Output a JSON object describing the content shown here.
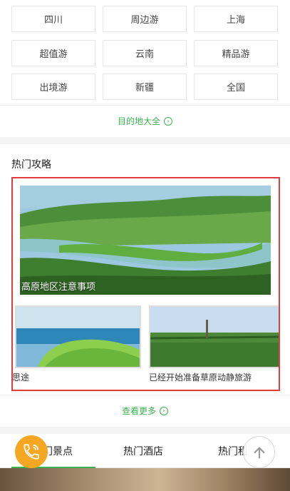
{
  "destinations": {
    "items": [
      {
        "label": "四川"
      },
      {
        "label": "周边游"
      },
      {
        "label": "上海"
      },
      {
        "label": "超值游"
      },
      {
        "label": "云南"
      },
      {
        "label": "精品游"
      },
      {
        "label": "出境游"
      },
      {
        "label": "新疆"
      },
      {
        "label": "全国"
      }
    ],
    "more_label": "目的地大全",
    "more_icon": "circle-arrow-right-icon"
  },
  "guides": {
    "title": "热门攻略",
    "featured": {
      "caption": "高原地区注意事项"
    },
    "cards": [
      {
        "caption": "思途"
      },
      {
        "caption": "已经开始准备草原动静旅游"
      }
    ],
    "more_label": "查看更多",
    "more_icon": "circle-arrow-right-icon"
  },
  "tabs": [
    {
      "label": "热门景点",
      "visible_text": "门景点"
    },
    {
      "label": "热门酒店"
    },
    {
      "label": "热门租车",
      "visible_text": "热门租"
    }
  ],
  "fabs": {
    "phone_icon": "phone-icon",
    "back_to_top_icon": "arrow-up-icon"
  },
  "colors": {
    "accent_green": "#3bb04f",
    "highlight_red": "#e43b3b",
    "phone_orange": "#f5a623"
  }
}
